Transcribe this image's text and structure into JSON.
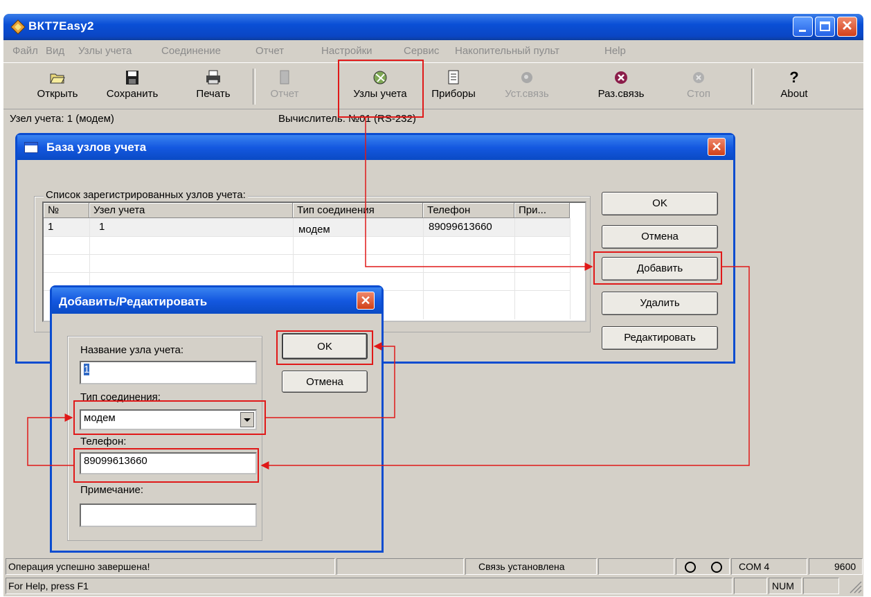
{
  "window": {
    "title": "ВКТ7Easy2"
  },
  "menu": [
    "Файл",
    "Вид",
    "Узлы учета",
    "Соединение",
    "Отчет",
    "Настройки",
    "Сервис",
    "Накопительный пульт",
    "Help"
  ],
  "toolbar": {
    "open": "Открыть",
    "save": "Сохранить",
    "print": "Печать",
    "report": "Отчет",
    "nodes": "Узлы учета",
    "devices": "Приборы",
    "connect": "Уст.связь",
    "disconnect": "Раз.связь",
    "stop": "Стоп",
    "about": "About"
  },
  "info": {
    "node": "Узел учета: 1   (модем)",
    "calc": "Вычислитель: №01 (RS-232)"
  },
  "base_dialog": {
    "title": "База узлов учета",
    "group": "Список зарегистрированных узлов учета:",
    "columns": [
      "№",
      "Узел учета",
      "Тип соединения",
      "Телефон",
      "При..."
    ],
    "rows": [
      {
        "num": "1",
        "node": "1",
        "type": "модем",
        "phone": "89099613660",
        "note": ""
      }
    ],
    "buttons": {
      "ok": "OK",
      "cancel": "Отмена",
      "add": "Добавить",
      "delete": "Удалить",
      "edit": "Редактировать"
    }
  },
  "edit_dialog": {
    "title": "Добавить/Редактировать",
    "name_label": "Название узла учета:",
    "name_value": "1",
    "type_label": "Тип соединения:",
    "type_value": "модем",
    "phone_label": "Телефон:",
    "phone_value": "89099613660",
    "note_label": "Примечание:",
    "note_value": "",
    "ok": "OK",
    "cancel": "Отмена"
  },
  "statusbar": {
    "message": "Операция успешно завершена!",
    "connection": "Связь установлена",
    "port": "COM 4",
    "baud": "9600",
    "help": "For Help, press F1",
    "num": "NUM"
  },
  "annotation_color": "#e01818"
}
